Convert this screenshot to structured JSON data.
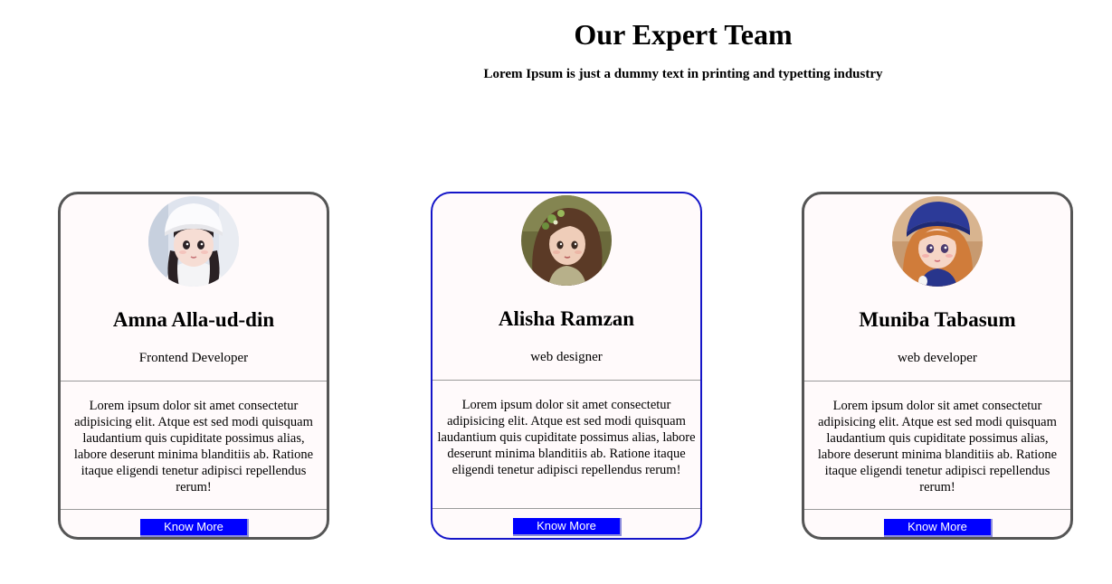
{
  "header": {
    "title": "Our Expert Team",
    "subtitle": "Lorem Ipsum is just a dummy text in printing and typetting industry"
  },
  "cards": [
    {
      "name": "Amna Alla-ud-din",
      "role": "Frontend Developer",
      "description": "Lorem ipsum dolor sit amet consectetur adipisicing elit. Atque est sed modi quisquam laudantium quis cupiditate possimus alias, labore deserunt minima blanditiis ab. Ratione itaque eligendi tenetur adipisci repellendus rerum!",
      "button_label": "Know More",
      "avatar": "girl-white-hat-avatar"
    },
    {
      "name": "Alisha Ramzan",
      "role": "web designer",
      "description": "Lorem ipsum dolor sit amet consectetur adipisicing elit. Atque est sed modi quisquam laudantium quis cupiditate possimus alias, labore deserunt minima blanditiis ab. Ratione itaque eligendi tenetur adipisci repellendus rerum!",
      "button_label": "Know More",
      "avatar": "girl-flower-crown-avatar"
    },
    {
      "name": "Muniba Tabasum",
      "role": "web developer",
      "description": "Lorem ipsum dolor sit amet consectetur adipisicing elit. Atque est sed modi quisquam laudantium quis cupiditate possimus alias, labore deserunt minima blanditiis ab. Ratione itaque eligendi tenetur adipisci repellendus rerum!",
      "button_label": "Know More",
      "avatar": "girl-blue-beret-avatar"
    }
  ],
  "colors": {
    "button": "#0000ff",
    "active_border": "#1515c8",
    "card_border": "#555555",
    "card_background": "#fffafb"
  }
}
